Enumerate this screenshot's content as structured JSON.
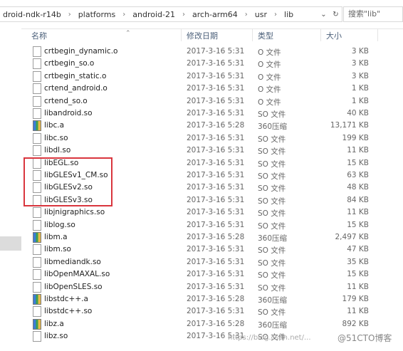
{
  "address": {
    "crumbs": [
      "droid-ndk-r14b",
      "platforms",
      "android-21",
      "arch-arm64",
      "usr",
      "lib"
    ],
    "refresh_symbol": "↻",
    "dropdown_symbol": "⌄",
    "search_placeholder": "搜索\"lib\""
  },
  "columns": {
    "name": "名称",
    "date": "修改日期",
    "type": "类型",
    "size": "大小"
  },
  "files": [
    {
      "name": "crtbegin_dynamic.o",
      "date": "2017-3-16 5:31",
      "type": "O 文件",
      "size": "3 KB",
      "icon": "file-icon"
    },
    {
      "name": "crtbegin_so.o",
      "date": "2017-3-16 5:31",
      "type": "O 文件",
      "size": "3 KB",
      "icon": "file-icon"
    },
    {
      "name": "crtbegin_static.o",
      "date": "2017-3-16 5:31",
      "type": "O 文件",
      "size": "3 KB",
      "icon": "file-icon"
    },
    {
      "name": "crtend_android.o",
      "date": "2017-3-16 5:31",
      "type": "O 文件",
      "size": "1 KB",
      "icon": "file-icon"
    },
    {
      "name": "crtend_so.o",
      "date": "2017-3-16 5:31",
      "type": "O 文件",
      "size": "1 KB",
      "icon": "file-icon"
    },
    {
      "name": "libandroid.so",
      "date": "2017-3-16 5:31",
      "type": "SO 文件",
      "size": "40 KB",
      "icon": "file-icon"
    },
    {
      "name": "libc.a",
      "date": "2017-3-16 5:28",
      "type": "360压缩",
      "size": "13,171 KB",
      "icon": "zip-icon"
    },
    {
      "name": "libc.so",
      "date": "2017-3-16 5:31",
      "type": "SO 文件",
      "size": "199 KB",
      "icon": "file-icon"
    },
    {
      "name": "libdl.so",
      "date": "2017-3-16 5:31",
      "type": "SO 文件",
      "size": "11 KB",
      "icon": "file-icon"
    },
    {
      "name": "libEGL.so",
      "date": "2017-3-16 5:31",
      "type": "SO 文件",
      "size": "15 KB",
      "icon": "file-icon"
    },
    {
      "name": "libGLESv1_CM.so",
      "date": "2017-3-16 5:31",
      "type": "SO 文件",
      "size": "63 KB",
      "icon": "file-icon"
    },
    {
      "name": "libGLESv2.so",
      "date": "2017-3-16 5:31",
      "type": "SO 文件",
      "size": "48 KB",
      "icon": "file-icon"
    },
    {
      "name": "libGLESv3.so",
      "date": "2017-3-16 5:31",
      "type": "SO 文件",
      "size": "84 KB",
      "icon": "file-icon"
    },
    {
      "name": "libjnigraphics.so",
      "date": "2017-3-16 5:31",
      "type": "SO 文件",
      "size": "11 KB",
      "icon": "file-icon"
    },
    {
      "name": "liblog.so",
      "date": "2017-3-16 5:31",
      "type": "SO 文件",
      "size": "15 KB",
      "icon": "file-icon"
    },
    {
      "name": "libm.a",
      "date": "2017-3-16 5:28",
      "type": "360压缩",
      "size": "2,497 KB",
      "icon": "zip-icon"
    },
    {
      "name": "libm.so",
      "date": "2017-3-16 5:31",
      "type": "SO 文件",
      "size": "47 KB",
      "icon": "file-icon"
    },
    {
      "name": "libmediandk.so",
      "date": "2017-3-16 5:31",
      "type": "SO 文件",
      "size": "35 KB",
      "icon": "file-icon"
    },
    {
      "name": "libOpenMAXAL.so",
      "date": "2017-3-16 5:31",
      "type": "SO 文件",
      "size": "15 KB",
      "icon": "file-icon"
    },
    {
      "name": "libOpenSLES.so",
      "date": "2017-3-16 5:31",
      "type": "SO 文件",
      "size": "11 KB",
      "icon": "file-icon"
    },
    {
      "name": "libstdc++.a",
      "date": "2017-3-16 5:28",
      "type": "360压缩",
      "size": "179 KB",
      "icon": "zip-icon"
    },
    {
      "name": "libstdc++.so",
      "date": "2017-3-16 5:31",
      "type": "SO 文件",
      "size": "11 KB",
      "icon": "file-icon"
    },
    {
      "name": "libz.a",
      "date": "2017-3-16 5:28",
      "type": "360压缩",
      "size": "892 KB",
      "icon": "zip-icon"
    },
    {
      "name": "libz.so",
      "date": "2017-3-16 5:31",
      "type": "SO 文件",
      "size": "",
      "icon": "file-icon"
    }
  ],
  "watermark": "https://blog.csdn.net/...",
  "brand": "@51CTO博客",
  "colors": {
    "highlight": "#d9363e",
    "header_text": "#4c607a"
  }
}
